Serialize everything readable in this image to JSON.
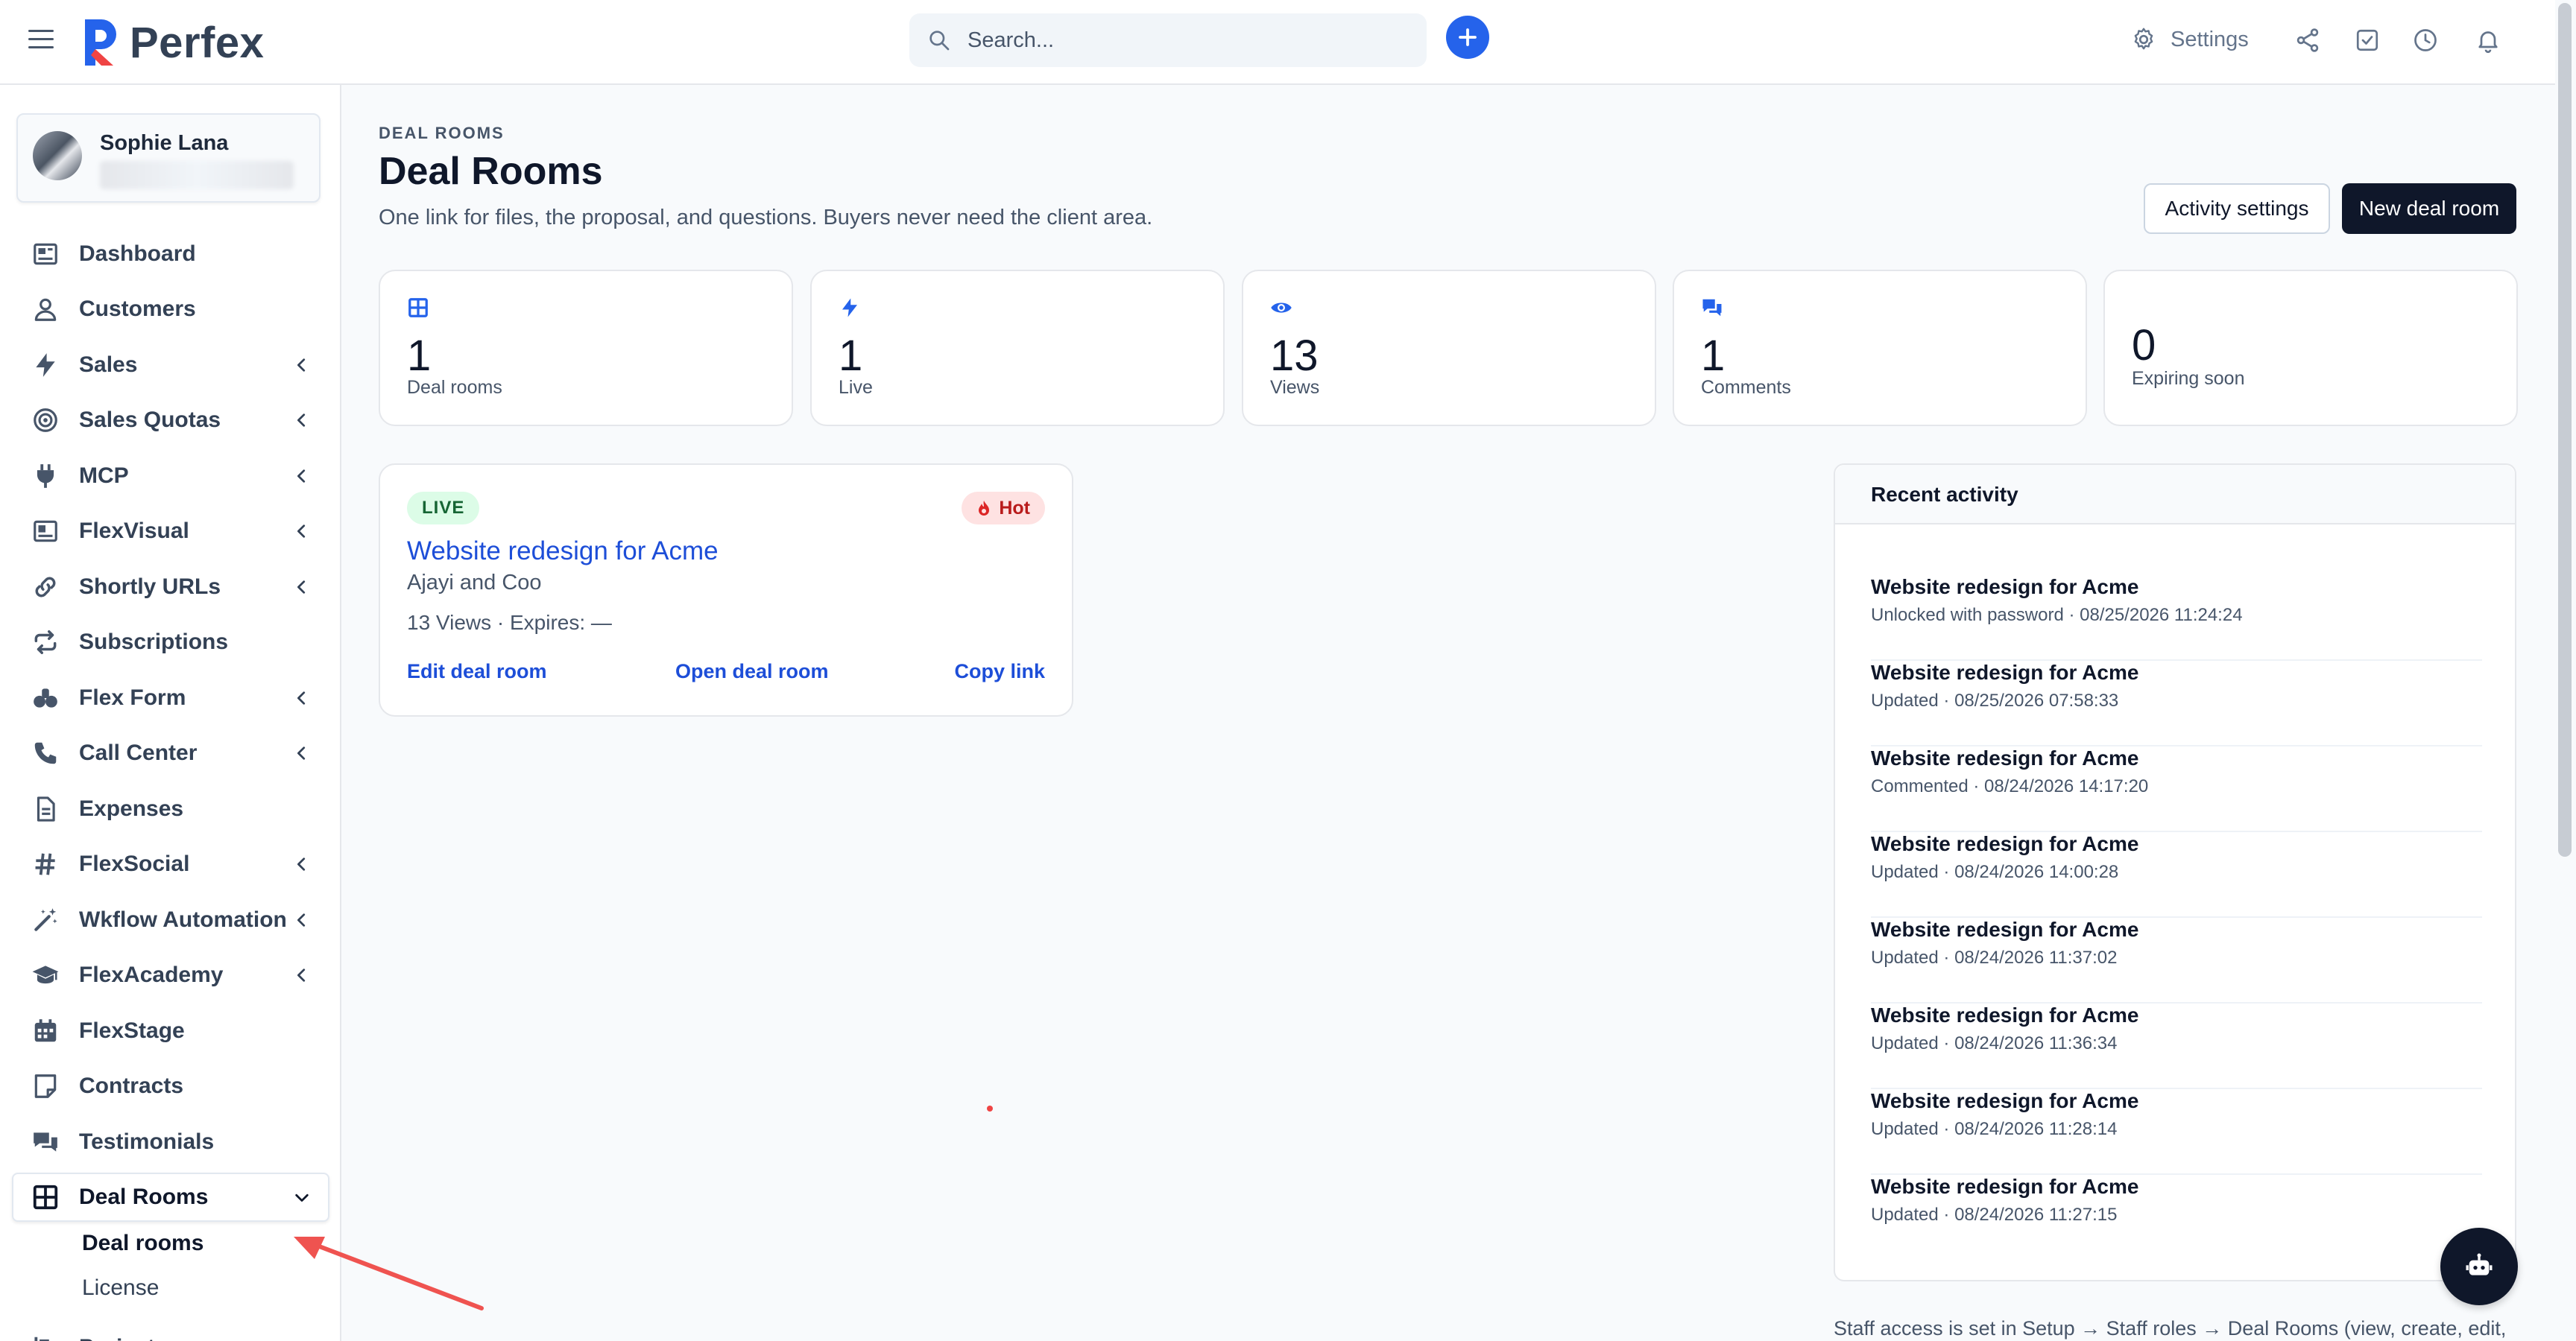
{
  "app": {
    "name": "Perfex"
  },
  "search": {
    "placeholder": "Search..."
  },
  "topbar": {
    "settings_label": "Settings"
  },
  "user": {
    "name": "Sophie Lana"
  },
  "sidebar": {
    "items": [
      {
        "label": "Dashboard",
        "icon": "dashboard-icon"
      },
      {
        "label": "Customers",
        "icon": "user-icon"
      },
      {
        "label": "Sales",
        "icon": "bolt-icon"
      },
      {
        "label": "Sales Quotas",
        "icon": "target-icon"
      },
      {
        "label": "MCP",
        "icon": "plug-icon"
      },
      {
        "label": "FlexVisual",
        "icon": "chart-icon"
      },
      {
        "label": "Shortly URLs",
        "icon": "link-icon"
      },
      {
        "label": "Subscriptions",
        "icon": "repeat-icon"
      },
      {
        "label": "Flex Form",
        "icon": "form-icon"
      },
      {
        "label": "Call Center",
        "icon": "phone-icon"
      },
      {
        "label": "Expenses",
        "icon": "file-icon"
      },
      {
        "label": "FlexSocial",
        "icon": "hashtag-icon"
      },
      {
        "label": "Wkflow Automation",
        "icon": "magic-wand-icon"
      },
      {
        "label": "FlexAcademy",
        "icon": "graduation-cap-icon"
      },
      {
        "label": "FlexStage",
        "icon": "calendar-icon"
      },
      {
        "label": "Contracts",
        "icon": "contract-icon"
      },
      {
        "label": "Testimonials",
        "icon": "comments-icon"
      },
      {
        "label": "Deal Rooms",
        "icon": "grid-icon"
      },
      {
        "label": "Projects",
        "icon": "projects-icon"
      }
    ],
    "sub_items": [
      {
        "label": "Deal rooms"
      },
      {
        "label": "License"
      }
    ]
  },
  "page": {
    "breadcrumb": "DEAL ROOMS",
    "title": "Deal Rooms",
    "subtitle": "One link for files, the proposal, and questions. Buyers never need the client area.",
    "activity_settings_label": "Activity settings",
    "new_deal_room_label": "New deal room"
  },
  "stats": [
    {
      "value": "1",
      "label": "Deal rooms",
      "icon": "grid-icon"
    },
    {
      "value": "1",
      "label": "Live",
      "icon": "bolt-icon"
    },
    {
      "value": "13",
      "label": "Views",
      "icon": "eye-icon"
    },
    {
      "value": "1",
      "label": "Comments",
      "icon": "comments-icon"
    },
    {
      "value": "0",
      "label": "Expiring soon",
      "icon": ""
    }
  ],
  "deal_card": {
    "status": "LIVE",
    "tag": "Hot",
    "title": "Website redesign for Acme",
    "client": "Ajayi and Coo",
    "meta": "13 Views · Expires: —",
    "edit_label": "Edit deal room",
    "open_label": "Open deal room",
    "copy_label": "Copy link"
  },
  "activity": {
    "title": "Recent activity",
    "items": [
      {
        "title": "Website redesign for Acme",
        "detail": "Unlocked with password · 08/25/2026 11:24:24"
      },
      {
        "title": "Website redesign for Acme",
        "detail": "Updated · 08/25/2026 07:58:33"
      },
      {
        "title": "Website redesign for Acme",
        "detail": "Commented · 08/24/2026 14:17:20"
      },
      {
        "title": "Website redesign for Acme",
        "detail": "Updated · 08/24/2026 14:00:28"
      },
      {
        "title": "Website redesign for Acme",
        "detail": "Updated · 08/24/2026 11:37:02"
      },
      {
        "title": "Website redesign for Acme",
        "detail": "Updated · 08/24/2026 11:36:34"
      },
      {
        "title": "Website redesign for Acme",
        "detail": "Updated · 08/24/2026 11:28:14"
      },
      {
        "title": "Website redesign for Acme",
        "detail": "Updated · 08/24/2026 11:27:15"
      }
    ]
  },
  "footnote": "Staff access is set in Setup → Staff roles → Deal Rooms (view, create, edit,",
  "colors": {
    "accent": "#2563eb",
    "link": "#1d4ed8",
    "dark": "#0f172a",
    "live_bg": "#dcfce7",
    "hot_bg": "#fee2e2"
  }
}
